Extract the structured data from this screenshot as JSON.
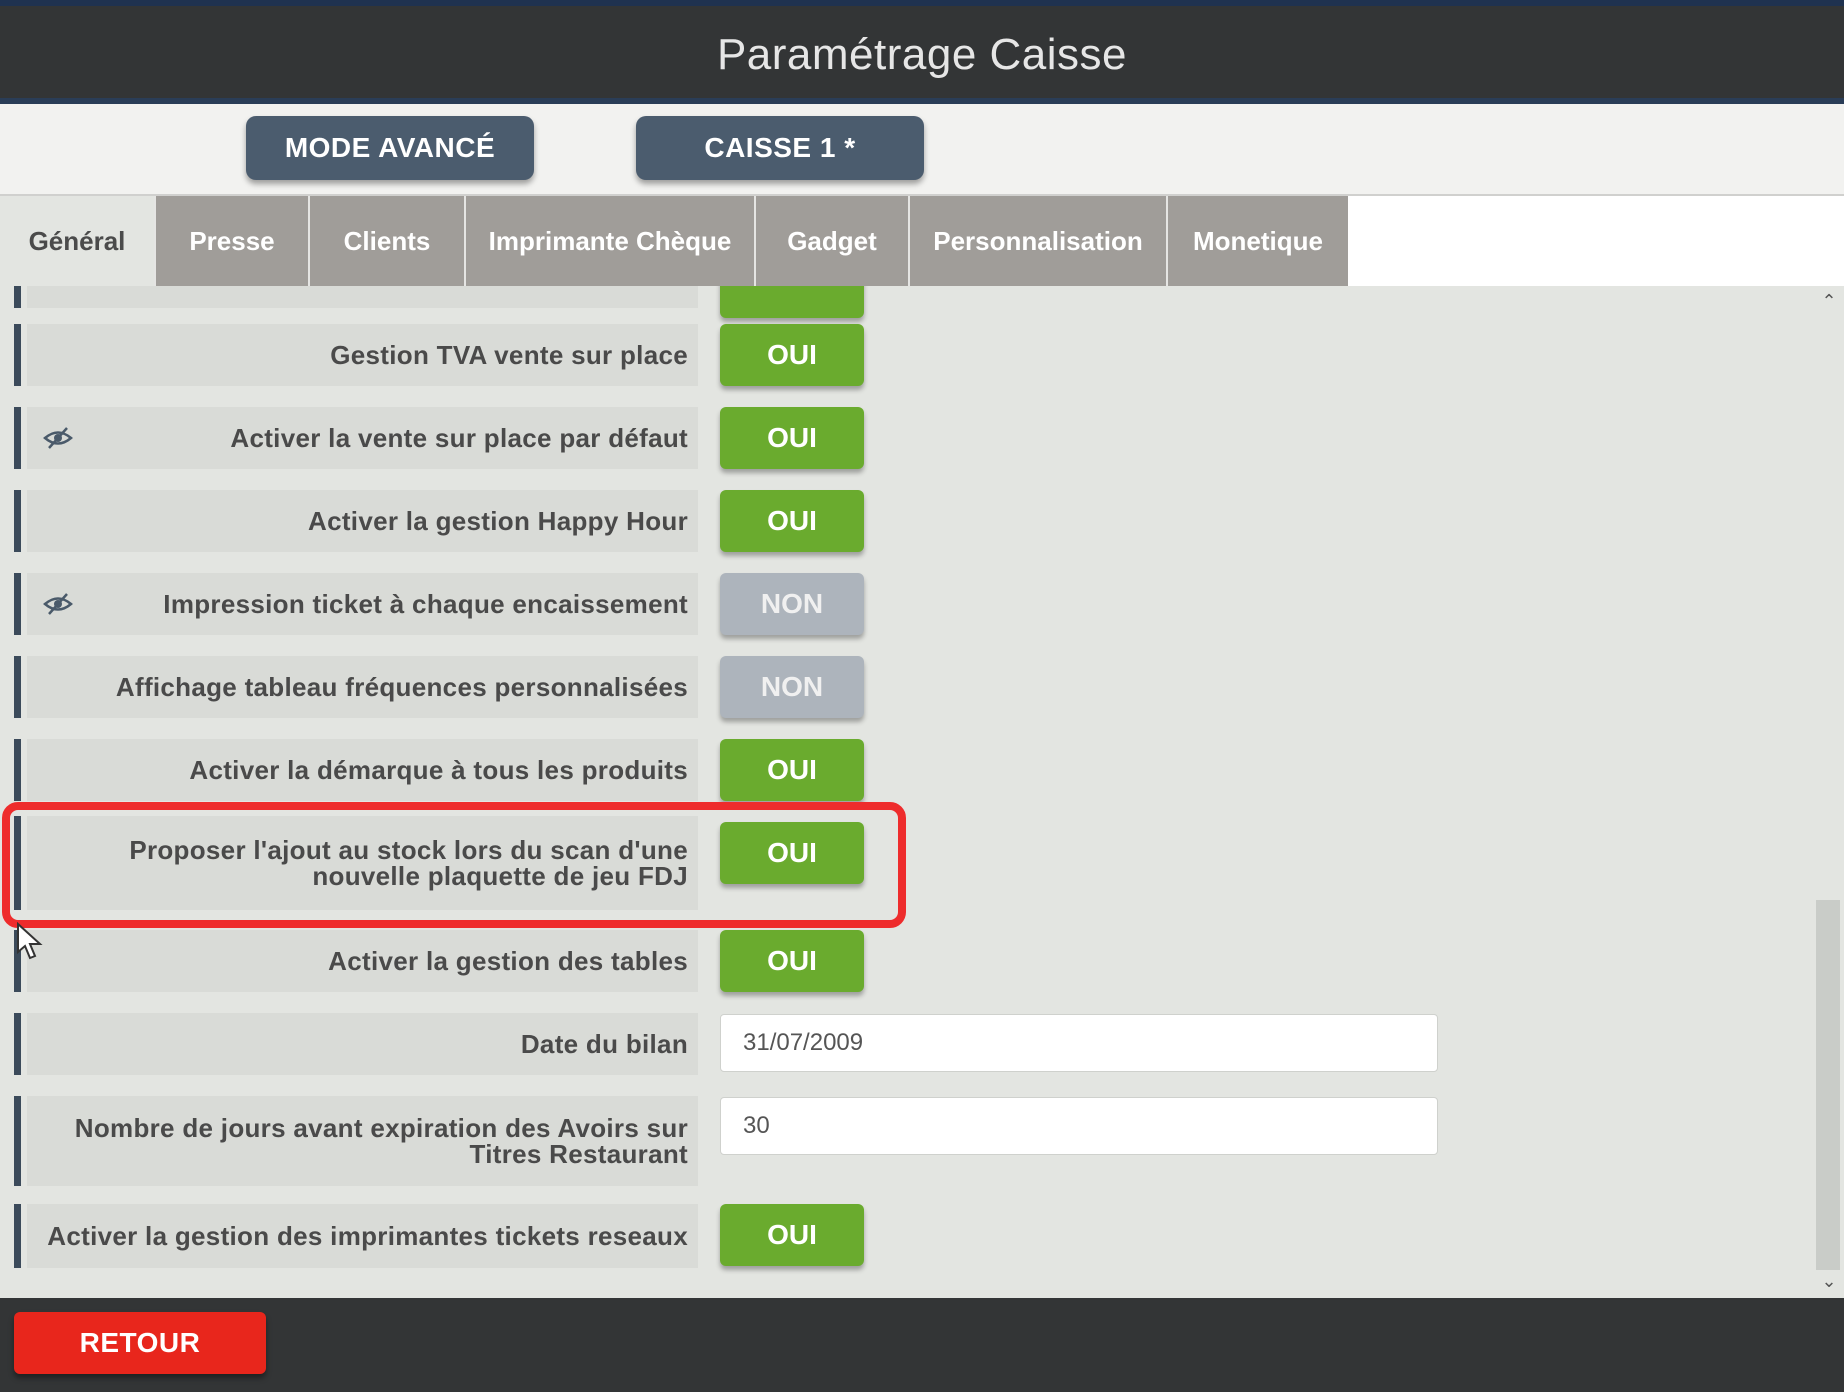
{
  "window": {
    "title": "Paramétrage Caisse"
  },
  "modebar": {
    "mode_label": "MODE AVANCÉ",
    "register_label": "CAISSE 1 *"
  },
  "tabs": [
    {
      "label": "Général",
      "active": true
    },
    {
      "label": "Presse"
    },
    {
      "label": "Clients"
    },
    {
      "label": "Imprimante Chèque"
    },
    {
      "label": "Gadget"
    },
    {
      "label": "Personnalisation"
    },
    {
      "label": "Monetique"
    }
  ],
  "settings": [
    {
      "label": "Gestion TVA vente sur place",
      "value": "OUI"
    },
    {
      "label": "Activer la vente sur place par défaut",
      "value": "OUI",
      "icon": "hidden-eye-icon"
    },
    {
      "label": "Activer la gestion Happy Hour",
      "value": "OUI"
    },
    {
      "label": "Impression ticket à chaque encaissement",
      "value": "NON",
      "icon": "hidden-eye-icon"
    },
    {
      "label": "Affichage tableau fréquences personnalisées",
      "value": "NON"
    },
    {
      "label": "Activer la démarque à tous les produits",
      "value": "OUI"
    },
    {
      "label_line1": "Proposer l'ajout au stock lors du scan d'une",
      "label_line2": "nouvelle plaquette de jeu FDJ",
      "value": "OUI",
      "highlighted": true
    },
    {
      "label": "Activer la gestion des tables",
      "value": "OUI"
    },
    {
      "label": "Date du bilan",
      "input_value": "31/07/2009"
    },
    {
      "label_line1": "Nombre de jours avant expiration des Avoirs sur",
      "label_line2": "Titres Restaurant",
      "input_value": "30"
    },
    {
      "label": "Activer la gestion des imprimantes tickets reseaux",
      "value": "OUI"
    }
  ],
  "footer": {
    "back_label": "RETOUR"
  },
  "colors": {
    "on": "#6aab2e",
    "off": "#adb4bc",
    "back": "#e8261c",
    "highlight": "#ee2c2c",
    "header": "#333536"
  }
}
